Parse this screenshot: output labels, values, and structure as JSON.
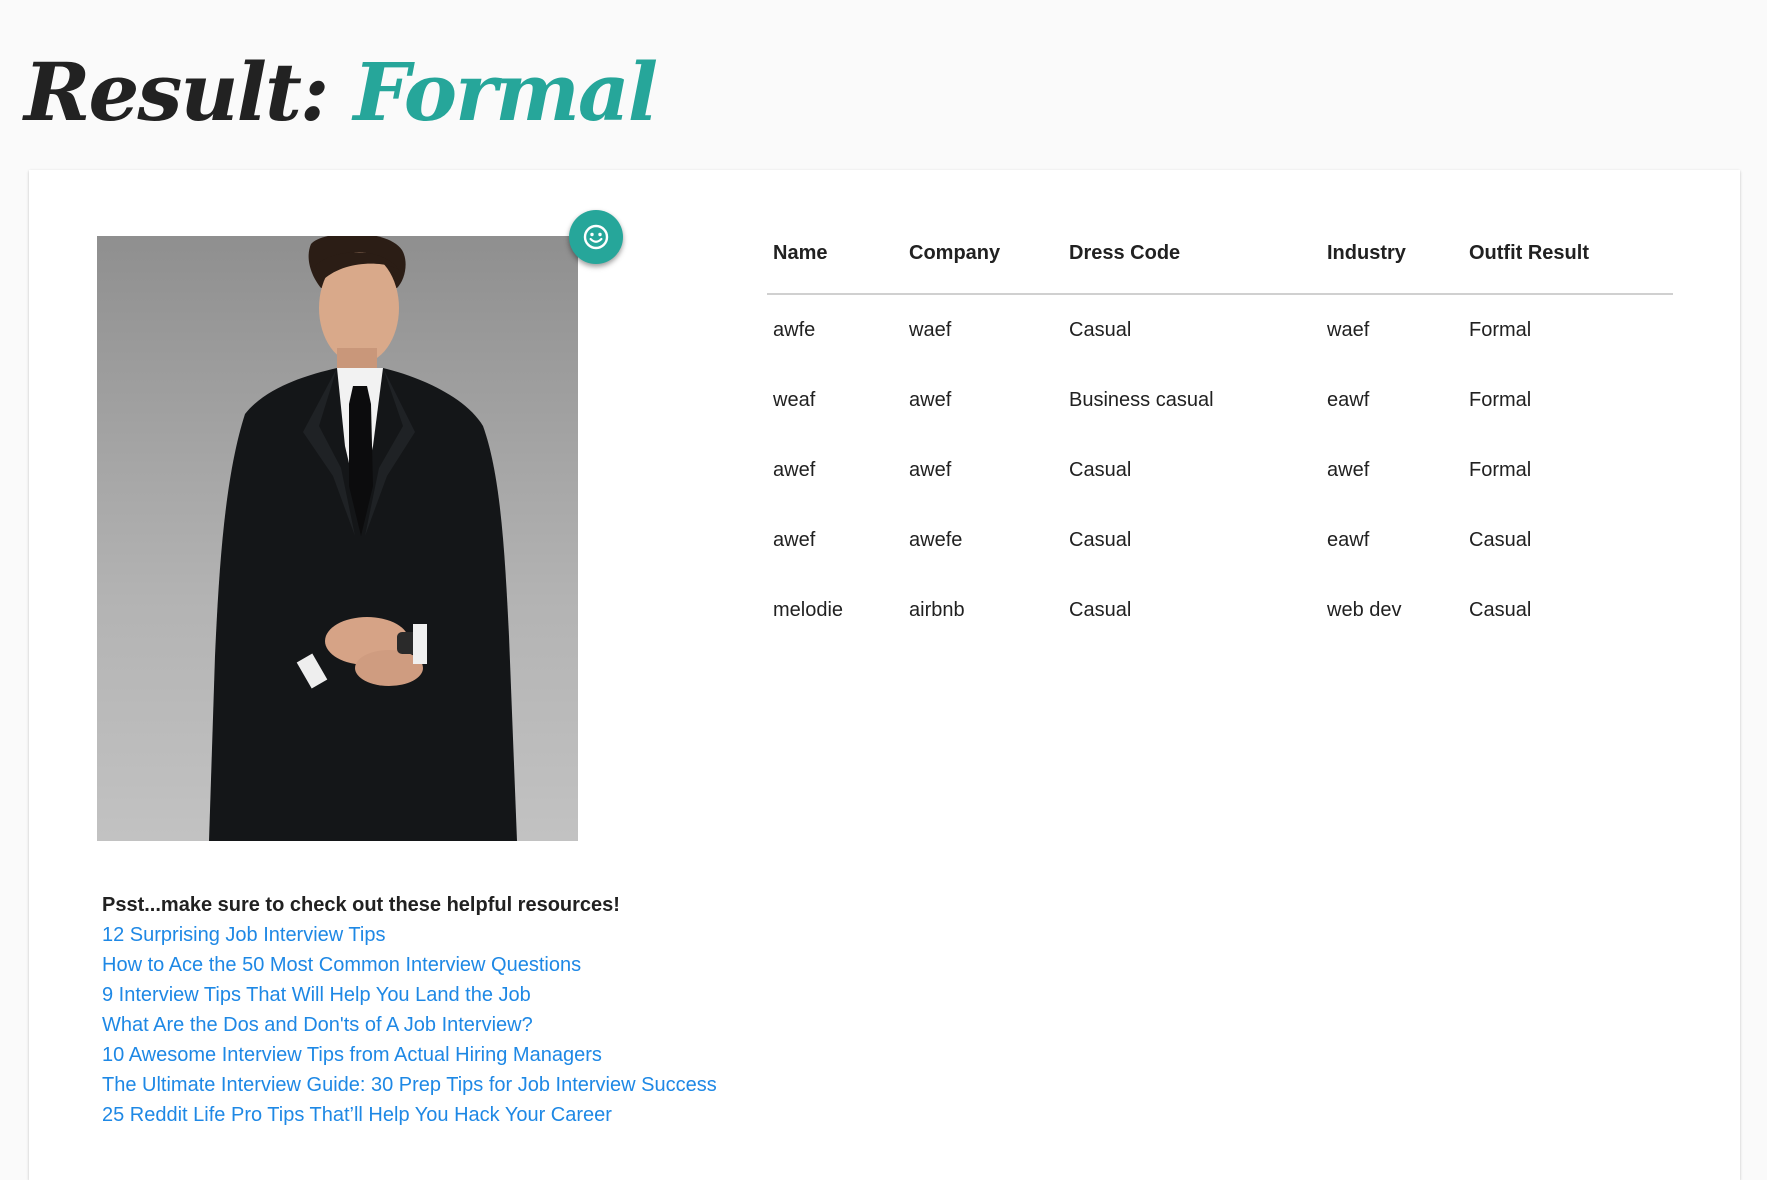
{
  "header": {
    "title_prefix": "Result:",
    "title_value": "Formal",
    "accent_color": "#26a69a"
  },
  "result_card": {
    "image": {
      "alt": "outfit-photo",
      "description_icon": "man-in-black-suit-photo"
    },
    "fab": {
      "icon": "smiley-face-icon",
      "color": "#26a69a"
    },
    "resources": {
      "heading": "Psst...make sure to check out these helpful resources!",
      "links": [
        "12 Surprising Job Interview Tips",
        "How to Ace the 50 Most Common Interview Questions",
        "9 Interview Tips That Will Help You Land the Job",
        "What Are the Dos and Don'ts of A Job Interview?",
        "10 Awesome Interview Tips from Actual Hiring Managers",
        "The Ultimate Interview Guide: 30 Prep Tips for Job Interview Success",
        "25 Reddit Life Pro Tips That’ll Help You Hack Your Career"
      ],
      "link_color": "#1e88e5"
    },
    "table": {
      "columns": [
        "Name",
        "Company",
        "Dress Code",
        "Industry",
        "Outfit Result"
      ],
      "rows": [
        [
          "awfe",
          "waef",
          "Casual",
          "waef",
          "Formal"
        ],
        [
          "weaf",
          "awef",
          "Business casual",
          "eawf",
          "Formal"
        ],
        [
          "awef",
          "awef",
          "Casual",
          "awef",
          "Formal"
        ],
        [
          "awef",
          "awefe",
          "Casual",
          "eawf",
          "Casual"
        ],
        [
          "melodie",
          "airbnb",
          "Casual",
          "web dev",
          "Casual"
        ]
      ]
    }
  }
}
